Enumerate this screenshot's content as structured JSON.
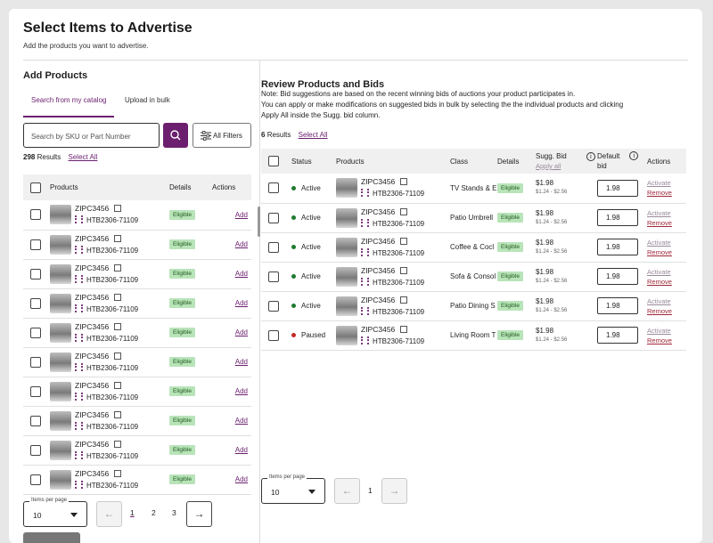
{
  "header": {
    "title": "Select Items to Advertise",
    "subtitle": "Add the products you want to advertise."
  },
  "left": {
    "title": "Add Products",
    "tabs": [
      {
        "label": "Search from my catalog",
        "active": true
      },
      {
        "label": "Upload in bulk",
        "active": false
      }
    ],
    "search": {
      "placeholder": "Search by SKU or Part Number",
      "filters_label": "All Filters"
    },
    "results_count": "298",
    "results_label": "Results",
    "select_all": "Select All",
    "columns": {
      "products": "Products",
      "details": "Details",
      "actions": "Actions"
    },
    "rows": [
      {
        "sku": "ZIPC3456",
        "part": "HTB2306-71109",
        "badge": "Eligible",
        "action": "Add"
      },
      {
        "sku": "ZIPC3456",
        "part": "HTB2306-71109",
        "badge": "Eligible",
        "action": "Add"
      },
      {
        "sku": "ZIPC3456",
        "part": "HTB2306-71109",
        "badge": "Eligible",
        "action": "Add"
      },
      {
        "sku": "ZIPC3456",
        "part": "HTB2306-71109",
        "badge": "Eligible",
        "action": "Add"
      },
      {
        "sku": "ZIPC3456",
        "part": "HTB2306-71109",
        "badge": "Eligible",
        "action": "Add"
      },
      {
        "sku": "ZIPC3456",
        "part": "HTB2306-71109",
        "badge": "Eligible",
        "action": "Add"
      },
      {
        "sku": "ZIPC3456",
        "part": "HTB2306-71109",
        "badge": "Eligible",
        "action": "Add"
      },
      {
        "sku": "ZIPC3456",
        "part": "HTB2306-71109",
        "badge": "Eligible",
        "action": "Add"
      },
      {
        "sku": "ZIPC3456",
        "part": "HTB2306-71109",
        "badge": "Eligible",
        "action": "Add"
      },
      {
        "sku": "ZIPC3456",
        "part": "HTB2306-71109",
        "badge": "Eligible",
        "action": "Add"
      }
    ],
    "pagination": {
      "ipp_label": "Items per page",
      "ipp_value": "10",
      "pages": [
        "1",
        "2",
        "3"
      ],
      "current": "1"
    }
  },
  "right": {
    "title": "Review Products and  Bids",
    "note_lines": [
      "Note: Bid suggestions are based on the recent winning bids of auctions your product participates in.",
      "You can apply or make modifications on suggested bids in bulk by selecting the the individual products and clicking",
      "Apply All inside the Sugg. bid column."
    ],
    "results_count": "6",
    "results_label": "Results",
    "select_all": "Select All",
    "columns": {
      "status": "Status",
      "products": "Products",
      "class": "Class",
      "details": "Details",
      "sugg_bid": "Sugg. Bid",
      "apply_all": "Apply all",
      "default_bid": "Default bid",
      "actions": "Actions"
    },
    "rows": [
      {
        "status": "Active",
        "status_color": "#1e7a2e",
        "sku": "ZIPC3456",
        "part": "HTB2306-71109",
        "class": "TV Stands & E",
        "badge": "Eligible",
        "sugg": "$1.98",
        "range": "$1.24 - $2.56",
        "bid": "1.98",
        "activate": "Activate",
        "remove": "Remove"
      },
      {
        "status": "Active",
        "status_color": "#1e7a2e",
        "sku": "ZIPC3456",
        "part": "HTB2306-71109",
        "class": "Patio Umbrell",
        "badge": "Eligible",
        "sugg": "$1.98",
        "range": "$1.24 - $2.56",
        "bid": "1.98",
        "activate": "Activate",
        "remove": "Remove"
      },
      {
        "status": "Active",
        "status_color": "#1e7a2e",
        "sku": "ZIPC3456",
        "part": "HTB2306-71109",
        "class": "Coffee & Cocl",
        "badge": "Eligible",
        "sugg": "$1.98",
        "range": "$1.24 - $2.56",
        "bid": "1.98",
        "activate": "Activate",
        "remove": "Remove"
      },
      {
        "status": "Active",
        "status_color": "#1e7a2e",
        "sku": "ZIPC3456",
        "part": "HTB2306-71109",
        "class": "Sofa & Consol",
        "badge": "Eligible",
        "sugg": "$1.98",
        "range": "$1.24 - $2.56",
        "bid": "1.98",
        "activate": "Activate",
        "remove": "Remove"
      },
      {
        "status": "Active",
        "status_color": "#1e7a2e",
        "sku": "ZIPC3456",
        "part": "HTB2306-71109",
        "class": "Patio Dining S",
        "badge": "Eligible",
        "sugg": "$1.98",
        "range": "$1.24 - $2.56",
        "bid": "1.98",
        "activate": "Activate",
        "remove": "Remove"
      },
      {
        "status": "Paused",
        "status_color": "#c62828",
        "sku": "ZIPC3456",
        "part": "HTB2306-71109",
        "class": "Living Room T",
        "badge": "Eligible",
        "sugg": "$1.98",
        "range": "$1.24 - $2.56",
        "bid": "1.98",
        "activate": "Activate",
        "remove": "Remove"
      }
    ],
    "pagination": {
      "ipp_label": "Items per page",
      "ipp_value": "10",
      "pages": [
        "1"
      ],
      "current": "1"
    }
  }
}
